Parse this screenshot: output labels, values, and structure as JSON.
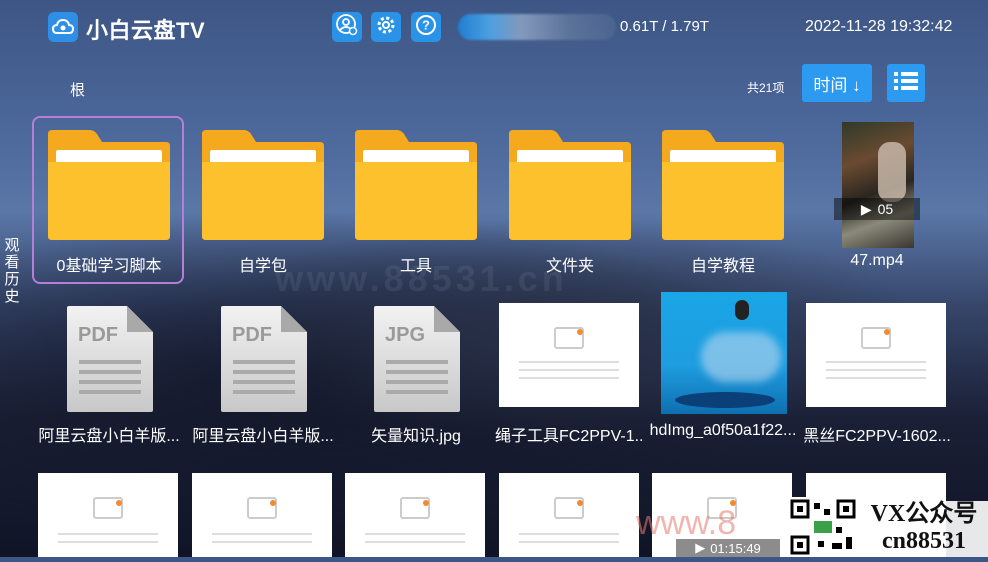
{
  "header": {
    "app_title": "小白云盘TV",
    "storage": "0.61T / 1.79T",
    "datetime": "2022-11-28 19:32:42",
    "icons": [
      "cloud-logo-icon",
      "user-settings-icon",
      "gear-icon",
      "help-icon"
    ]
  },
  "toolbar": {
    "breadcrumb": "根",
    "count": "共21项",
    "sort_label": "时间 ↓",
    "view_icon": "list-view-icon"
  },
  "side": {
    "history_label": "观看历史"
  },
  "files": {
    "row1": [
      {
        "name": "0基础学习脚本",
        "type": "folder",
        "selected": true
      },
      {
        "name": "自学包",
        "type": "folder"
      },
      {
        "name": "工具",
        "type": "folder"
      },
      {
        "name": "文件夹",
        "type": "folder"
      },
      {
        "name": "自学教程",
        "type": "folder"
      },
      {
        "name": "47.mp4",
        "type": "video",
        "duration": "05"
      }
    ],
    "row2": [
      {
        "name": "阿里云盘小白羊版...",
        "type": "pdf",
        "badge": "PDF"
      },
      {
        "name": "阿里云盘小白羊版...",
        "type": "pdf",
        "badge": "PDF"
      },
      {
        "name": "矢量知识.jpg",
        "type": "jpg",
        "badge": "JPG"
      },
      {
        "name": "绳子工具FC2PPV-1...",
        "type": "image-placeholder"
      },
      {
        "name": "hdImg_a0f50a1f22...",
        "type": "image"
      },
      {
        "name": "黑丝FC2PPV-1602...",
        "type": "image-placeholder"
      }
    ],
    "row3_duration": "01:15:49"
  },
  "watermarks": {
    "center": "www.88531.cn",
    "bottom": "www.8",
    "vx_line1": "VX公众号",
    "vx_line2": "cn88531"
  }
}
